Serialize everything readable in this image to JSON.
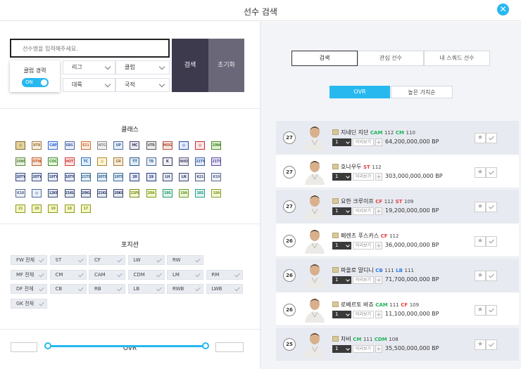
{
  "header": {
    "title": "선수 검색",
    "close_icon": "close-icon"
  },
  "search": {
    "placeholder": "선수명을 입력해주세요.",
    "value": "",
    "search_label": "검색",
    "reset_label": "초기화",
    "club_career_label": "클럽 경력",
    "club_career_toggle": "ON"
  },
  "filters": {
    "league": "리그",
    "club": "클럽",
    "continent": "대륙",
    "nation": "국적"
  },
  "class_section": {
    "title": "클래스",
    "badges": [
      {
        "t": "",
        "bg": "#e6d39a",
        "fg": "#7a6a3a"
      },
      {
        "t": "BTB",
        "bg": "#f6f0e6",
        "fg": "#a0793a"
      },
      {
        "t": "CAP",
        "bg": "#e8eefb",
        "fg": "#3064d6"
      },
      {
        "t": "EBS",
        "bg": "#eef2fa",
        "fg": "#4c64a8"
      },
      {
        "t": "E21",
        "bg": "#fbeee6",
        "fg": "#d06b2a"
      },
      {
        "t": "NTG",
        "bg": "#f3f3f3",
        "fg": "#888888"
      },
      {
        "t": "UP",
        "bg": "#e7eef7",
        "fg": "#4a6aa0"
      },
      {
        "t": "MC",
        "bg": "#eaeaf0",
        "fg": "#444466"
      },
      {
        "t": "VTR",
        "bg": "#eeeeee",
        "fg": "#555555"
      },
      {
        "t": "MOG",
        "bg": "#f8e8e4",
        "fg": "#b0503a"
      },
      {
        "t": "",
        "bg": "#e4ecfa",
        "fg": "#2a4aa8"
      },
      {
        "t": "",
        "bg": "#fbe6e6",
        "fg": "#c03030"
      },
      {
        "t": "20NG",
        "bg": "#e2f2d6",
        "fg": "#4a8a2a"
      },
      {
        "t": "19NG",
        "bg": "#e6f0e0",
        "fg": "#5a8a3a"
      },
      {
        "t": "OTW",
        "bg": "#f9e6dc",
        "fg": "#c05a2a"
      },
      {
        "t": "COC",
        "bg": "#eaf6e0",
        "fg": "#3a8a2a"
      },
      {
        "t": "HOT",
        "bg": "#fbe6e6",
        "fg": "#d03a3a"
      },
      {
        "t": "TC",
        "bg": "#e2eef8",
        "fg": "#2a6ab0"
      },
      {
        "t": "",
        "bg": "#fff4d6",
        "fg": "#b08a2a"
      },
      {
        "t": "GR",
        "bg": "#f6eedc",
        "fg": "#a07a3a"
      },
      {
        "t": "TT",
        "bg": "#e0ecf6",
        "fg": "#2a5a90"
      },
      {
        "t": "TB",
        "bg": "#eaf0f8",
        "fg": "#4a6a98"
      },
      {
        "t": "K",
        "bg": "#eef0f4",
        "fg": "#333355"
      },
      {
        "t": "NHD",
        "bg": "#eaeaf0",
        "fg": "#555577"
      },
      {
        "t": "21TY",
        "bg": "#e4ecf8",
        "fg": "#3a5aa0"
      },
      {
        "t": "21TY",
        "bg": "#eae6f6",
        "fg": "#5a4aa0"
      },
      {
        "t": "20TY",
        "bg": "#e6eaf4",
        "fg": "#3a4a80"
      },
      {
        "t": "20TY",
        "bg": "#e6eaf4",
        "fg": "#3a4a80"
      },
      {
        "t": "19TY",
        "bg": "#e6eaf4",
        "fg": "#3a4a80"
      },
      {
        "t": "18TY",
        "bg": "#e6eaf4",
        "fg": "#3a4a80"
      },
      {
        "t": "21TS",
        "bg": "#e4eef6",
        "fg": "#3a6a98"
      },
      {
        "t": "20TS",
        "bg": "#e4eef6",
        "fg": "#3a6a98"
      },
      {
        "t": "19TS",
        "bg": "#e4eef6",
        "fg": "#3a6a98"
      },
      {
        "t": "20",
        "bg": "#e4e8f4",
        "fg": "#2a3a80"
      },
      {
        "t": "19",
        "bg": "#e4e8f4",
        "fg": "#2a3a80"
      },
      {
        "t": "LH",
        "bg": "#e6eaf2",
        "fg": "#3a4a70"
      },
      {
        "t": "LN",
        "bg": "#e6eaf2",
        "fg": "#3a4a70"
      },
      {
        "t": "K21",
        "bg": "#eef0f6",
        "fg": "#4a5a80"
      },
      {
        "t": "K19",
        "bg": "#eef2f8",
        "fg": "#5a6a90"
      },
      {
        "t": "K18",
        "bg": "#eef2f8",
        "fg": "#5a6a90"
      },
      {
        "t": "",
        "bg": "#eaf0f8",
        "fg": "#4a6a98"
      },
      {
        "t": "12KH",
        "bg": "#e6eaf2",
        "fg": "#3a4a70"
      },
      {
        "t": "21KL",
        "bg": "#e6eaf2",
        "fg": "#3a4a70"
      },
      {
        "t": "20KL",
        "bg": "#e6eaf2",
        "fg": "#3a4a70"
      },
      {
        "t": "21KL",
        "bg": "#e6eaf2",
        "fg": "#3a4a70"
      },
      {
        "t": "20KL",
        "bg": "#e6eaf2",
        "fg": "#3a4a70"
      },
      {
        "t": "21PL",
        "bg": "#f4f8d6",
        "fg": "#7a8a1a"
      },
      {
        "t": "20A",
        "bg": "#f2f8d2",
        "fg": "#7a9a1a"
      },
      {
        "t": "19S",
        "bg": "#e0f6ee",
        "fg": "#2a9a6a"
      },
      {
        "t": "19A",
        "bg": "#eef8d8",
        "fg": "#6a9a2a"
      },
      {
        "t": "18S",
        "bg": "#e0f6f2",
        "fg": "#2a9a8a"
      },
      {
        "t": "18A",
        "bg": "#f4f8d8",
        "fg": "#8a9a2a"
      },
      {
        "t": "21",
        "bg": "#f4f6c8",
        "fg": "#8a9a1a"
      },
      {
        "t": "20",
        "bg": "#f4f6c8",
        "fg": "#8a9a1a"
      },
      {
        "t": "19",
        "bg": "#f4f6c8",
        "fg": "#8a9a1a"
      },
      {
        "t": "18",
        "bg": "#f4f6c8",
        "fg": "#8a9a1a"
      },
      {
        "t": "17",
        "bg": "#f4f6c8",
        "fg": "#8a9a1a"
      }
    ]
  },
  "position_section": {
    "title": "포지션",
    "rows": [
      [
        "FW 전체",
        "ST",
        "CF",
        "LW",
        "RW"
      ],
      [
        "MF 전체",
        "CM",
        "CAM",
        "CDM",
        "LM",
        "RM"
      ],
      [
        "DF 전체",
        "CB",
        "RB",
        "LB",
        "RWB",
        "LWB"
      ],
      [
        "GK 전체"
      ]
    ]
  },
  "ovr_section": {
    "title": "OVR"
  },
  "tabs": [
    {
      "label": "검색",
      "active": true
    },
    {
      "label": "관심 선수",
      "active": false
    },
    {
      "label": "내 스쿼드 선수",
      "active": false
    }
  ],
  "sort": {
    "ovr": "OVR",
    "value": "높은 가치순"
  },
  "players": [
    {
      "name": "지네딘 지단",
      "ovr_badge": "27",
      "pos": [
        {
          "p": "CAM",
          "c": "g",
          "v": "112"
        },
        {
          "p": "CM",
          "c": "g",
          "v": "110"
        }
      ],
      "level": "1",
      "preview": "미리보기",
      "bp": "64,200,000,000 BP"
    },
    {
      "name": "호나우두",
      "ovr_badge": "27",
      "pos": [
        {
          "p": "ST",
          "c": "r",
          "v": "112"
        }
      ],
      "level": "1",
      "preview": "미리보기",
      "bp": "303,000,000,000 BP"
    },
    {
      "name": "요한 크루이프",
      "ovr_badge": "27",
      "pos": [
        {
          "p": "CF",
          "c": "r",
          "v": "112"
        },
        {
          "p": "ST",
          "c": "r",
          "v": "109"
        }
      ],
      "level": "1",
      "preview": "미리보기",
      "bp": "19,200,000,000 BP"
    },
    {
      "name": "페렌츠 푸스카스",
      "ovr_badge": "26",
      "pos": [
        {
          "p": "CF",
          "c": "r",
          "v": "112"
        }
      ],
      "level": "1",
      "preview": "미리보기",
      "bp": "36,000,000,000 BP"
    },
    {
      "name": "파올로 말디니",
      "ovr_badge": "26",
      "pos": [
        {
          "p": "CB",
          "c": "b",
          "v": "111"
        },
        {
          "p": "LB",
          "c": "b",
          "v": "111"
        }
      ],
      "level": "1",
      "preview": "미리보기",
      "bp": "71,700,000,000 BP"
    },
    {
      "name": "로베르토 바죠",
      "ovr_badge": "26",
      "pos": [
        {
          "p": "CAM",
          "c": "g",
          "v": "111"
        },
        {
          "p": "CF",
          "c": "r",
          "v": "109"
        }
      ],
      "level": "1",
      "preview": "미리보기",
      "bp": "11,100,000,000 BP"
    },
    {
      "name": "차비",
      "ovr_badge": "25",
      "pos": [
        {
          "p": "CM",
          "c": "g",
          "v": "111"
        },
        {
          "p": "CDM",
          "c": "g",
          "v": "108"
        }
      ],
      "level": "1",
      "preview": "미리보기",
      "bp": "35,500,000,000 BP"
    }
  ],
  "colors": {
    "accent": "#27b8f0",
    "dark_button": "#3d3a4d",
    "reset_button": "#6a6878"
  }
}
